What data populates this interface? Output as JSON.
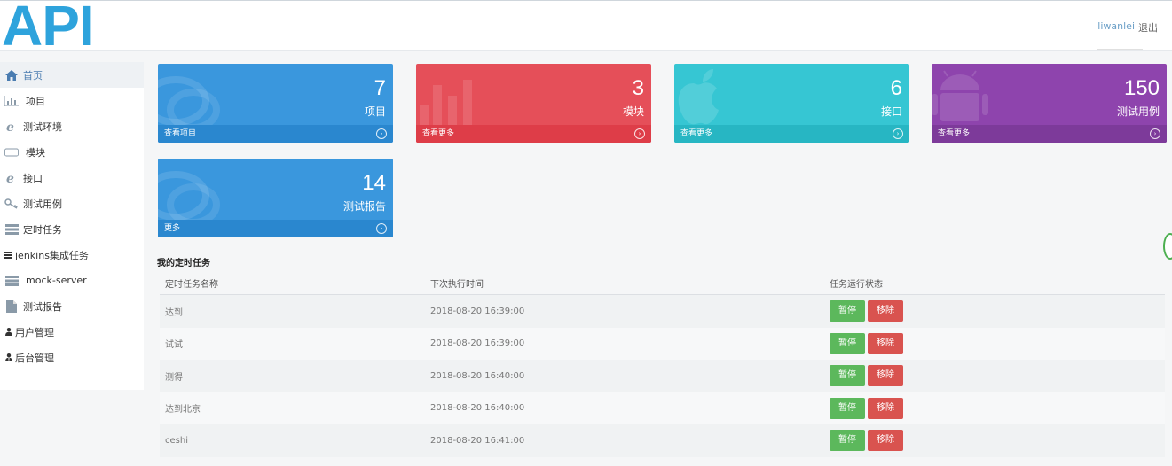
{
  "header": {
    "logo": "API",
    "user": "liwanlei",
    "logout": "退出"
  },
  "sidebar": {
    "items": [
      {
        "label": "首页",
        "icon": "home-icon"
      },
      {
        "label": "项目",
        "icon": "bar-chart-icon"
      },
      {
        "label": "测试环境",
        "icon": "ie-icon"
      },
      {
        "label": "模块",
        "icon": "rectangle-icon"
      },
      {
        "label": "接口",
        "icon": "ie-icon"
      },
      {
        "label": "测试用例",
        "icon": "key-icon"
      },
      {
        "label": "定时任务",
        "icon": "server-icon"
      },
      {
        "label": "jenkins集成任务",
        "icon": "server-icon"
      },
      {
        "label": "mock-server",
        "icon": "server-icon"
      },
      {
        "label": "测试报告",
        "icon": "file-icon"
      },
      {
        "label": "用户管理",
        "icon": "user-icon"
      },
      {
        "label": "后台管理",
        "icon": "user-tie-icon"
      }
    ]
  },
  "cards": [
    {
      "number": "7",
      "label": "项目",
      "footer": "查看项目",
      "color": "#3a97dd"
    },
    {
      "number": "3",
      "label": "模块",
      "footer": "查看更多",
      "color": "#e54f59"
    },
    {
      "number": "6",
      "label": "接口",
      "footer": "查看更多",
      "color": "#36c6d3"
    },
    {
      "number": "150",
      "label": "测试用例",
      "footer": "查看更多",
      "color": "#8e44ad"
    },
    {
      "number": "14",
      "label": "测试报告",
      "footer": "更多",
      "color": "#3a97dd"
    }
  ],
  "tasks": {
    "title": "我的定时任务",
    "headers": [
      "定时任务名称",
      "下次执行时间",
      "任务运行状态"
    ],
    "pause_label": "暂停",
    "remove_label": "移除",
    "rows": [
      {
        "name": "达到",
        "time": "2018-08-20 16:39:00"
      },
      {
        "name": "试试",
        "time": "2018-08-20 16:39:00"
      },
      {
        "name": "测得",
        "time": "2018-08-20 16:40:00"
      },
      {
        "name": "达到北京",
        "time": "2018-08-20 16:40:00"
      },
      {
        "name": "ceshi",
        "time": "2018-08-20 16:41:00"
      }
    ]
  }
}
